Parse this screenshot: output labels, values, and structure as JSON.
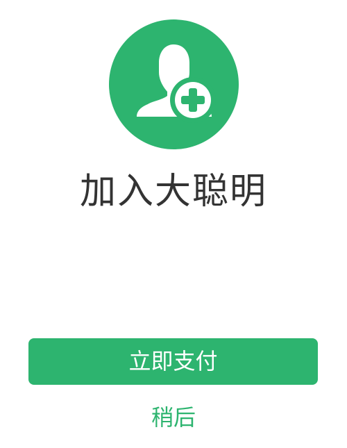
{
  "header": {
    "icon": "add-user-icon",
    "title": "加入大聪明"
  },
  "actions": {
    "pay_label": "立即支付",
    "later_label": "稍后"
  },
  "colors": {
    "accent": "#2db46f",
    "title_text": "#333333",
    "button_text": "#ffffff",
    "background": "#ffffff"
  }
}
